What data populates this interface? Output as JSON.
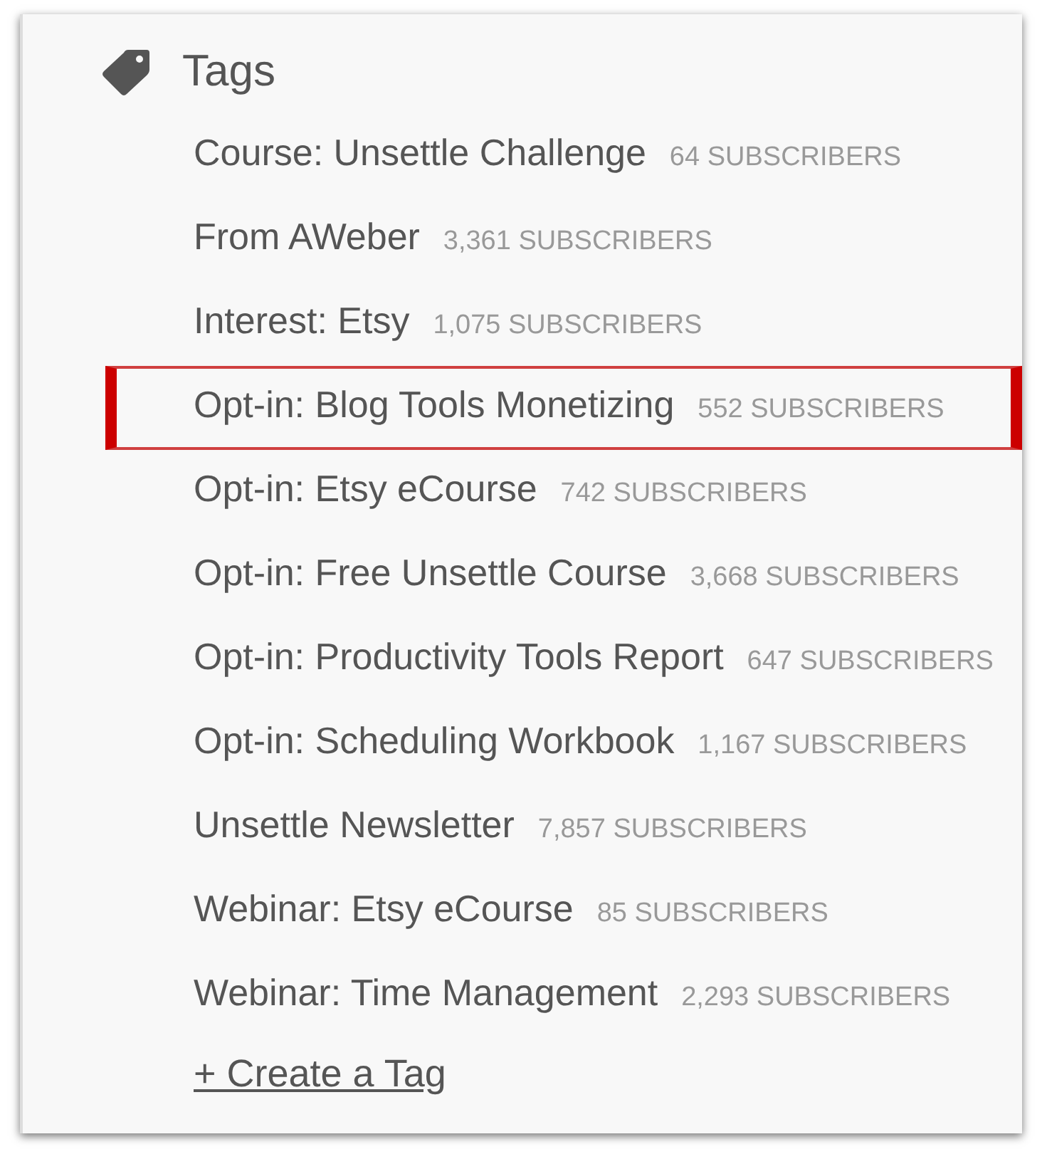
{
  "title": "Tags",
  "tags": [
    {
      "name": "Course: Unsettle Challenge",
      "count": "64 SUBSCRIBERS",
      "selected": false
    },
    {
      "name": "From AWeber",
      "count": "3,361 SUBSCRIBERS",
      "selected": false
    },
    {
      "name": "Interest: Etsy",
      "count": "1,075 SUBSCRIBERS",
      "selected": false
    },
    {
      "name": "Opt-in: Blog Tools Monetizing",
      "count": "552 SUBSCRIBERS",
      "selected": true
    },
    {
      "name": "Opt-in: Etsy eCourse",
      "count": "742 SUBSCRIBERS",
      "selected": false
    },
    {
      "name": "Opt-in: Free Unsettle Course",
      "count": "3,668 SUBSCRIBERS",
      "selected": false
    },
    {
      "name": "Opt-in: Productivity Tools Report",
      "count": "647 SUBSCRIBERS",
      "selected": false
    },
    {
      "name": "Opt-in: Scheduling Workbook",
      "count": "1,167 SUBSCRIBERS",
      "selected": false
    },
    {
      "name": "Unsettle Newsletter",
      "count": "7,857 SUBSCRIBERS",
      "selected": false
    },
    {
      "name": "Webinar: Etsy eCourse",
      "count": "85 SUBSCRIBERS",
      "selected": false
    },
    {
      "name": "Webinar: Time Management",
      "count": "2,293 SUBSCRIBERS",
      "selected": false
    }
  ],
  "create_link": "+ Create a Tag"
}
